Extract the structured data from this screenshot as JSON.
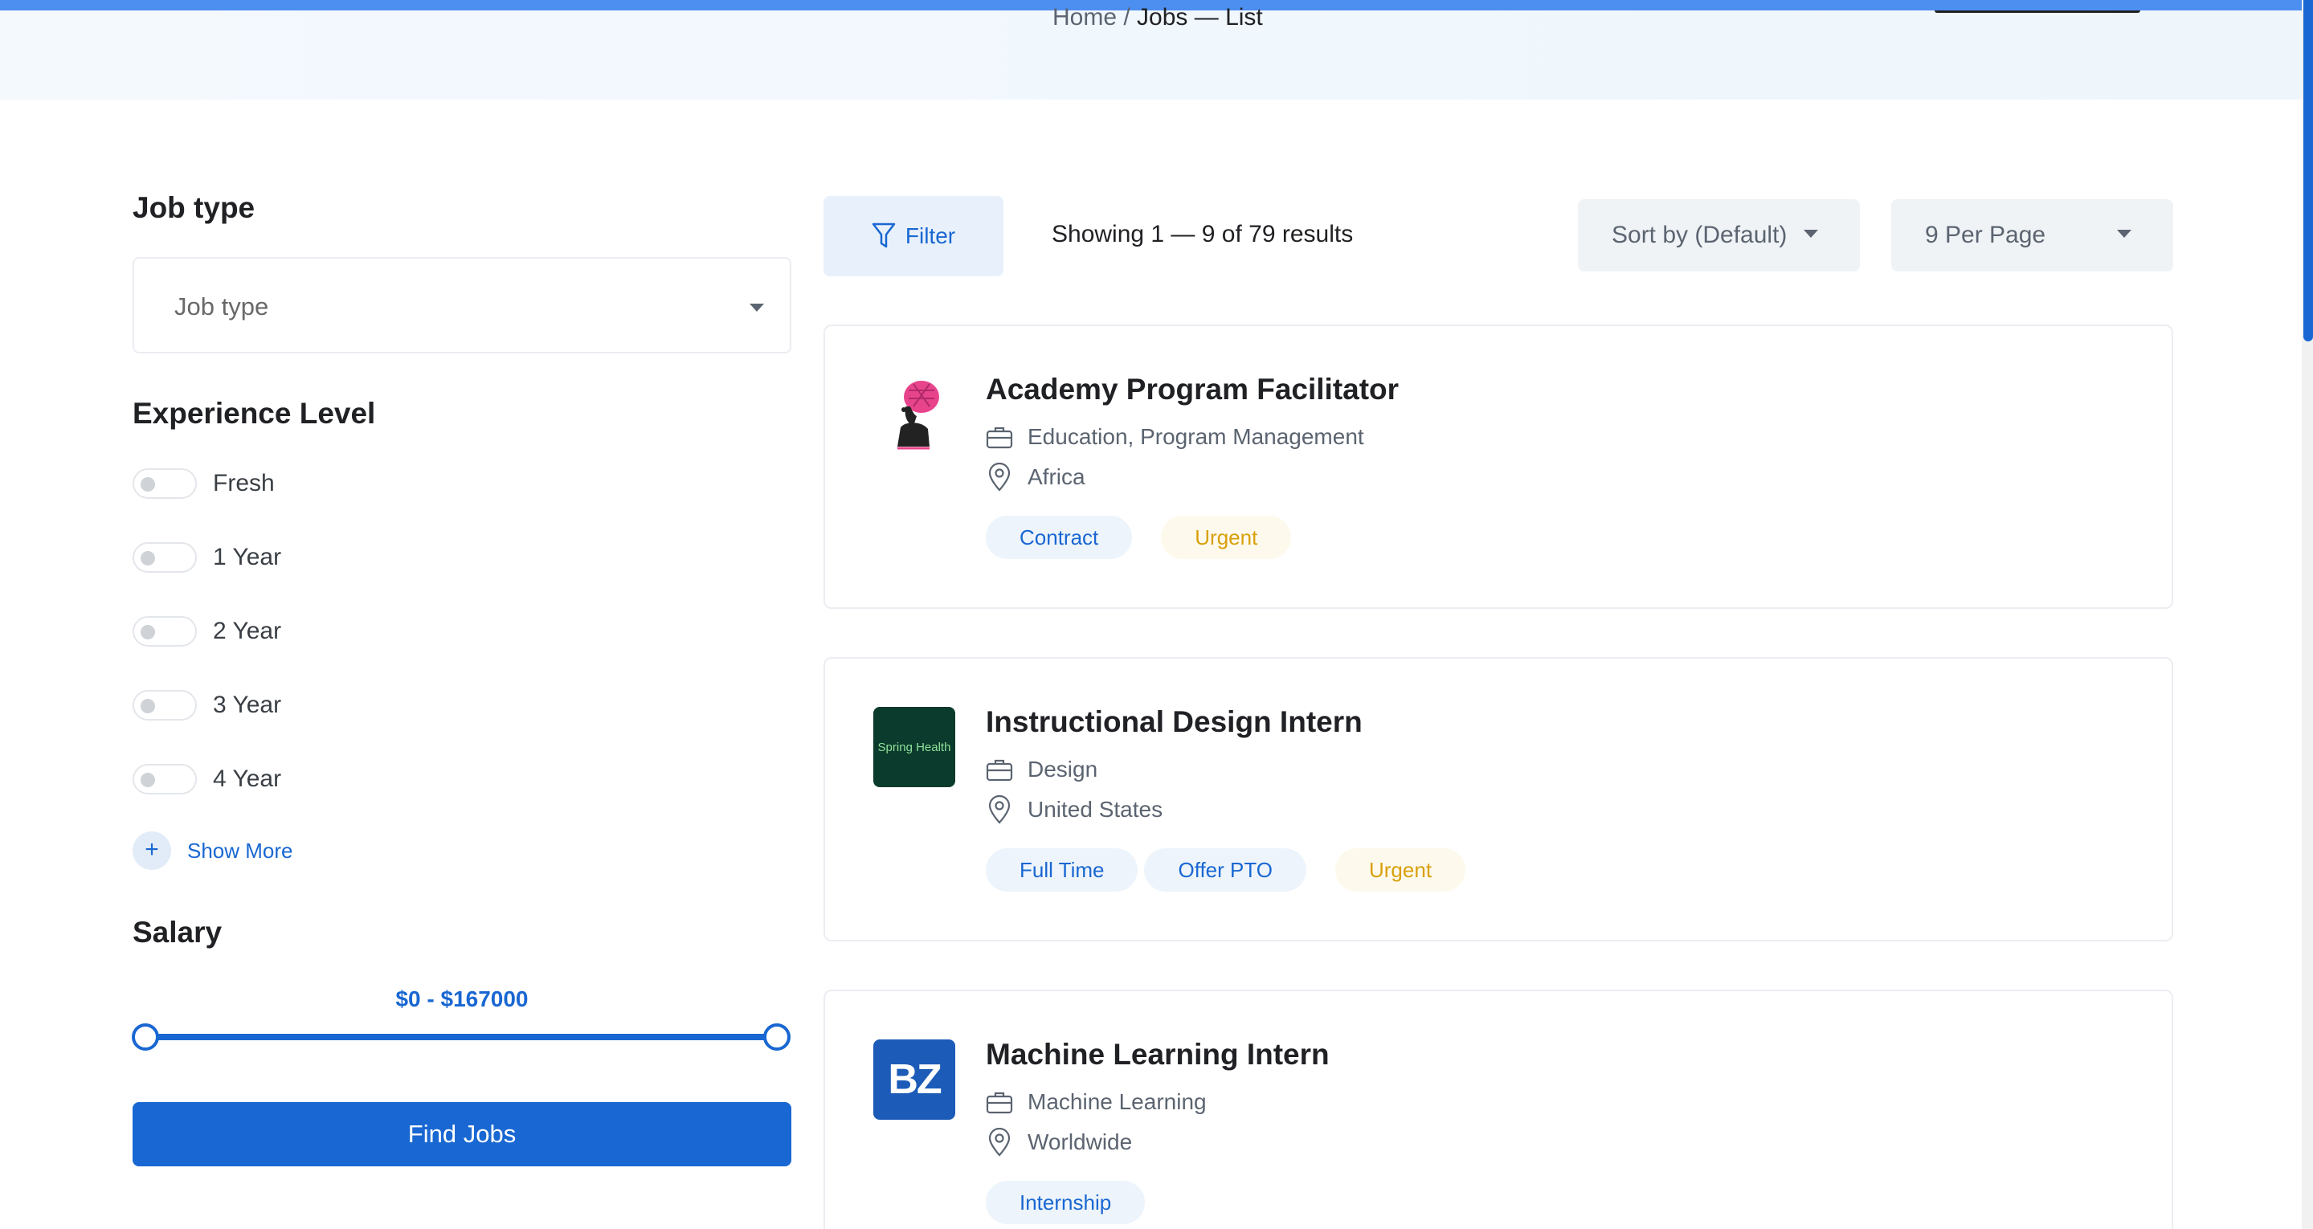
{
  "breadcrumb": {
    "home": "Home",
    "sep": " / ",
    "current": "Jobs — List"
  },
  "sidebar": {
    "job_type": {
      "title": "Job type",
      "select_value": "Job type"
    },
    "experience": {
      "title": "Experience Level",
      "items": [
        "Fresh",
        "1 Year",
        "2 Year",
        "3 Year",
        "4 Year"
      ],
      "show_more": "Show More"
    },
    "salary": {
      "title": "Salary",
      "range": "$0 - $167000",
      "min": 0,
      "max": 167000
    },
    "find_button": "Find Jobs"
  },
  "toolbar": {
    "filter_label": "Filter",
    "showing": "Showing 1 — 9 of 79 results",
    "sort_label": "Sort by (Default)",
    "per_page_label": "9 Per Page"
  },
  "jobs": [
    {
      "title": "Academy Program Facilitator",
      "category": "Education, Program Management",
      "location": "Africa",
      "tags": [
        "Contract"
      ],
      "urgent": "Urgent",
      "logo": "woman-headwrap-logo"
    },
    {
      "title": "Instructional Design Intern",
      "category": "Design",
      "location": "United States",
      "tags": [
        "Full Time",
        "Offer PTO"
      ],
      "urgent": "Urgent",
      "logo_text": "Spring Health",
      "logo_color": "#0b3b2c"
    },
    {
      "title": "Machine Learning Intern",
      "category": "Machine Learning",
      "location": "Worldwide",
      "tags": [
        "Internship"
      ],
      "logo_text": "BZ",
      "logo_color": "#1c5bb8"
    }
  ],
  "colors": {
    "primary": "#1967d2",
    "urgent": "#d9a00c"
  }
}
